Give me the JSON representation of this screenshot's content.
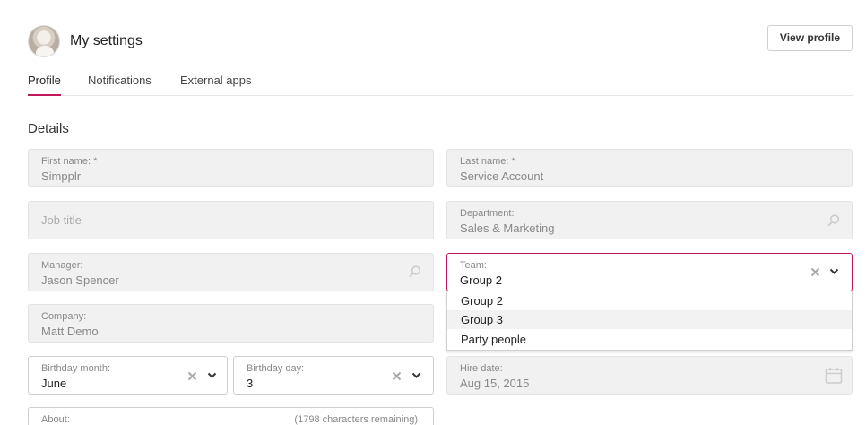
{
  "header": {
    "title": "My settings",
    "view_profile_label": "View profile"
  },
  "tabs": [
    {
      "label": "Profile",
      "active": true
    },
    {
      "label": "Notifications",
      "active": false
    },
    {
      "label": "External apps",
      "active": false
    }
  ],
  "section": {
    "title": "Details"
  },
  "fields": {
    "first_name": {
      "label": "First name: *",
      "value": "Simpplr"
    },
    "last_name": {
      "label": "Last name: *",
      "value": "Service Account"
    },
    "job_title": {
      "placeholder": "Job title"
    },
    "department": {
      "label": "Department:",
      "value": "Sales & Marketing"
    },
    "manager": {
      "label": "Manager:",
      "value": "Jason Spencer"
    },
    "team": {
      "label": "Team:",
      "value": "Group 2"
    },
    "company": {
      "label": "Company:",
      "value": "Matt Demo"
    },
    "birthday_month": {
      "label": "Birthday month:",
      "value": "June"
    },
    "birthday_day": {
      "label": "Birthday day:",
      "value": "3"
    },
    "hire_date": {
      "label": "Hire date:",
      "value": "Aug 15, 2015"
    },
    "about": {
      "label": "About:",
      "counter": "(1798 characters remaining)"
    }
  },
  "team_options": [
    "Group 2",
    "Group 3",
    "Party people"
  ],
  "icons": {
    "search": "search-icon",
    "clear": "clear-icon",
    "chevron": "chevron-down-icon",
    "calendar": "calendar-icon",
    "avatar": "avatar"
  },
  "colors": {
    "accent": "#c2185b",
    "disabled_bg": "#f1f1f1",
    "border": "#e3e3e3"
  }
}
